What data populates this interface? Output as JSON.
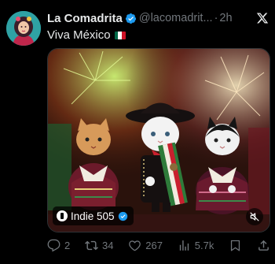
{
  "author": {
    "name": "La Comadrita",
    "handle": "@lacomadrit...",
    "separator": "·",
    "time": "2h"
  },
  "tweet": {
    "text": "Viva México"
  },
  "media": {
    "channel_name": "Indie 505"
  },
  "actions": {
    "replies": "2",
    "retweets": "34",
    "likes": "267",
    "views": "5.7k"
  },
  "colors": {
    "verified": "#1d9bf0",
    "muted_text": "#71767b",
    "text": "#e7e9ea"
  },
  "icons": {
    "platform": "x-logo-icon",
    "verified": "verified-badge-icon",
    "reply": "reply-icon",
    "retweet": "retweet-icon",
    "like": "heart-icon",
    "views": "views-icon",
    "bookmark": "bookmark-icon",
    "share": "share-icon",
    "mute": "mute-icon"
  }
}
